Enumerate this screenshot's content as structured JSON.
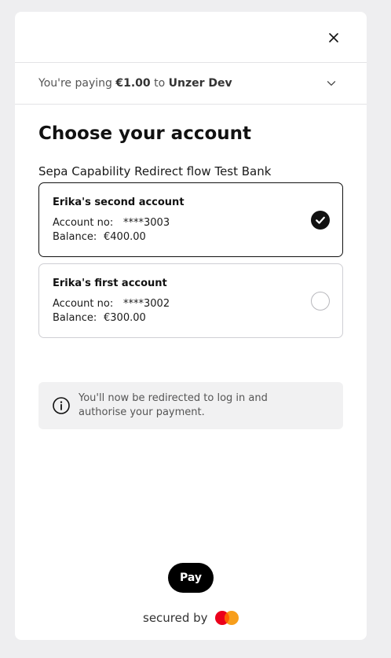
{
  "header": {
    "close_icon": "close-icon"
  },
  "summary": {
    "prefix": "You're paying",
    "amount": "€1.00",
    "connector": "to",
    "merchant": "Unzer Dev",
    "toggle_icon": "chevron-down-icon"
  },
  "page": {
    "title": "Choose your account",
    "bank_name": "Sepa Capability Redirect flow Test Bank"
  },
  "accounts": [
    {
      "name": "Erika's second account",
      "account_label": "Account no:",
      "account_number": "****3003",
      "balance_label": "Balance:",
      "balance": "€400.00",
      "selected": true
    },
    {
      "name": "Erika's first account",
      "account_label": "Account no:",
      "account_number": "****3002",
      "balance_label": "Balance:",
      "balance": "€300.00",
      "selected": false
    }
  ],
  "info": {
    "icon": "info-icon",
    "text": "You'll now be redirected to log in and authorise your payment."
  },
  "footer": {
    "pay_label": "Pay",
    "secured_label": "secured by",
    "logo": "mastercard-logo"
  },
  "colors": {
    "background": "#eeeef0",
    "card": "#ffffff",
    "primary": "#000000",
    "info_bg": "#f1f1f2",
    "mastercard_red": "#eb001b",
    "mastercard_orange": "#f79e1b"
  }
}
